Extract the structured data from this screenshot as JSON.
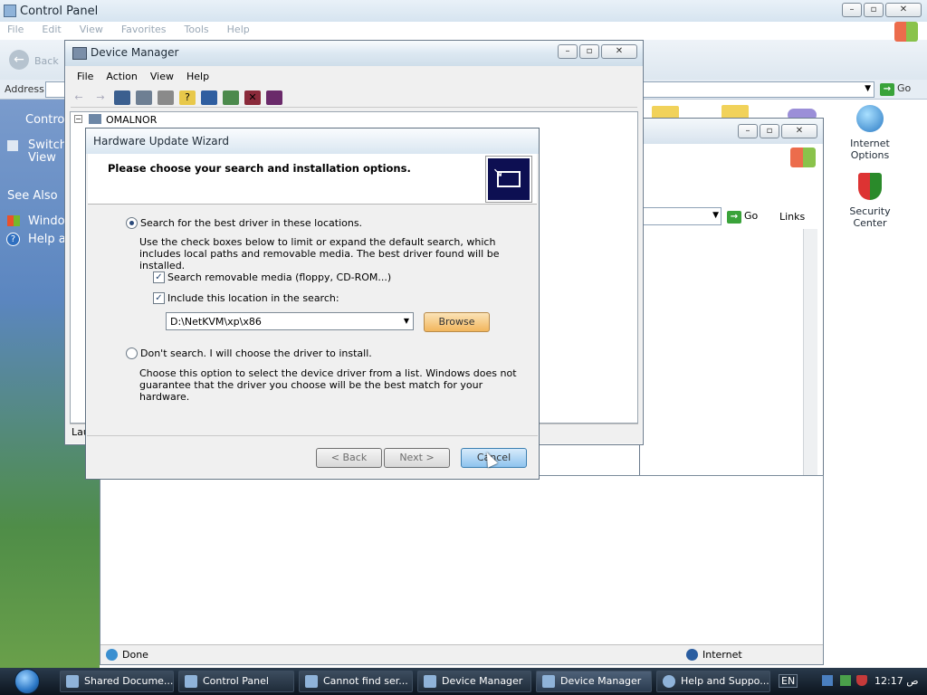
{
  "control_panel": {
    "title": "Control Panel",
    "menu": [
      "File",
      "Edit",
      "View",
      "Favorites",
      "Tools",
      "Help"
    ],
    "back_label": "Back",
    "address_label": "Address",
    "go_label": "Go",
    "tasks": {
      "heading": "Control",
      "switch_view": "Switch",
      "switch_view2": "View",
      "see_also": "See Also",
      "link1": "Window",
      "link2": "Help an"
    },
    "icons": {
      "internet_options": "Internet Options",
      "security_center": "Security Center"
    }
  },
  "ie": {
    "go_label": "Go",
    "links_label": "Links",
    "status_done": "Done",
    "status_zone": "Internet"
  },
  "device_manager": {
    "title": "Device Manager",
    "menu": [
      "File",
      "Action",
      "View",
      "Help"
    ],
    "tree_root": "OMALNOR",
    "status_text": "Lau"
  },
  "wizard": {
    "title": "Hardware Update Wizard",
    "heading": "Please choose your search and installation options.",
    "radio_search_label": "Search for the best driver in these locations.",
    "search_desc": "Use the check boxes below to limit or expand the default search, which includes local paths and removable media. The best driver found will be installed.",
    "chk_removable_label": "Search removable media (floppy, CD-ROM...)",
    "chk_removable_checked": true,
    "chk_include_label": "Include this location in the search:",
    "chk_include_checked": true,
    "location_value": "D:\\NetKVM\\xp\\x86",
    "browse_label": "Browse",
    "radio_dont_search_label": "Don't search. I will choose the driver to install.",
    "dont_search_desc": "Choose this option to select the device driver from a list.  Windows does not guarantee that the driver you choose will be the best match for your hardware.",
    "back_label": "< Back",
    "next_label": "Next >",
    "cancel_label": "Cancel"
  },
  "taskbar": {
    "items": [
      "Shared Docume...",
      "Control Panel",
      "Cannot find ser...",
      "Device Manager",
      "Device Manager",
      "Help and Suppo..."
    ],
    "language": "EN",
    "clock": "12:17 ص"
  }
}
